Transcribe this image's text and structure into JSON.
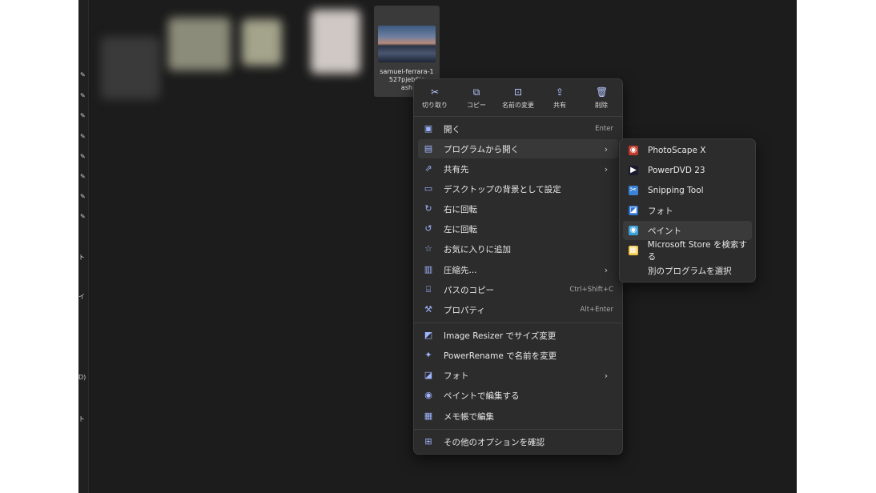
{
  "file": {
    "name": "samuel-ferrara-1527pjeb6jo-unsplash",
    "name_visible": "samuel-ferrara-1\n527pjeb6jc\nash"
  },
  "quick_actions": [
    {
      "label": "切り取り",
      "icon": "scissors-icon"
    },
    {
      "label": "コピー",
      "icon": "copy-icon"
    },
    {
      "label": "名前の変更",
      "icon": "rename-icon"
    },
    {
      "label": "共有",
      "icon": "share-icon"
    },
    {
      "label": "削除",
      "icon": "trash-icon"
    }
  ],
  "menu_items": [
    {
      "label": "開く",
      "shortcut": "Enter",
      "icon": "open-icon"
    },
    {
      "label": "プログラムから開く",
      "arrow": "›",
      "icon": "open-with-icon"
    },
    {
      "label": "共有先",
      "arrow": "›",
      "icon": "share-to-icon"
    },
    {
      "label": "デスクトップの背景として設定",
      "icon": "desktop-background-icon"
    },
    {
      "label": "右に回転",
      "icon": "rotate-right-icon"
    },
    {
      "label": "左に回転",
      "icon": "rotate-left-icon"
    },
    {
      "label": "お気に入りに追加",
      "icon": "star-icon"
    },
    {
      "label": "圧縮先...",
      "arrow": "›",
      "icon": "zip-icon"
    },
    {
      "label": "パスのコピー",
      "shortcut": "Ctrl+Shift+C",
      "icon": "copy-path-icon"
    },
    {
      "label": "プロパティ",
      "shortcut": "Alt+Enter",
      "icon": "wrench-icon"
    },
    {
      "label": "Image Resizer でサイズ変更",
      "icon": "image-resizer-icon"
    },
    {
      "label": "PowerRename で名前を変更",
      "icon": "powerrename-icon"
    },
    {
      "label": "フォト",
      "arrow": "›",
      "icon": "photos-icon"
    },
    {
      "label": "ペイントで編集する",
      "icon": "paint-icon"
    },
    {
      "label": "メモ帳で編集",
      "icon": "notepad-icon"
    },
    {
      "label": "その他のオプションを確認",
      "icon": "more-options-icon"
    }
  ],
  "submenu_items": [
    {
      "label": "PhotoScape X",
      "icon": "photoscape-icon",
      "color": "#c0392b"
    },
    {
      "label": "PowerDVD 23",
      "icon": "powerdvd-icon",
      "color": "#1b1b2e"
    },
    {
      "label": "Snipping Tool",
      "icon": "snipping-tool-icon",
      "color": "#3b82d6"
    },
    {
      "label": "フォト",
      "icon": "photos-icon",
      "color": "#2f74d0"
    },
    {
      "label": "ペイント",
      "icon": "paint-icon",
      "color": "#3aa0d8"
    },
    {
      "label": "Microsoft Store を検索する",
      "icon": "store-icon",
      "color": "#f2c94c"
    },
    {
      "label": "別のプログラムを選択",
      "icon": "",
      "color": ""
    }
  ],
  "edge_fragments": [
    "ト",
    "イ",
    "D)",
    "ト"
  ]
}
